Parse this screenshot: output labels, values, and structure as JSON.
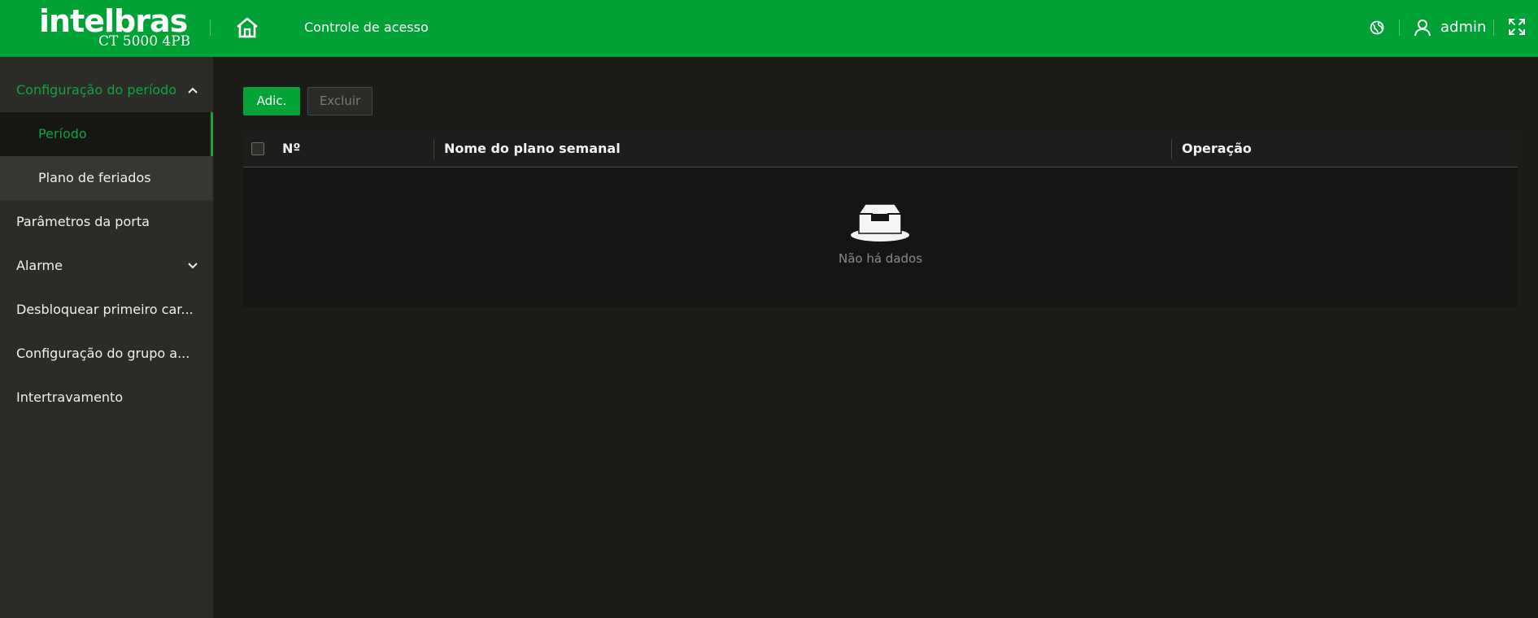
{
  "header": {
    "brand": "intelbras",
    "model": "CT 5000 4PB",
    "title": "Controle de acesso",
    "username": "admin"
  },
  "sidebar": {
    "items": [
      {
        "label": "Configuração do período",
        "state": "expanded"
      },
      {
        "label": "Período",
        "state": "selected"
      },
      {
        "label": "Plano de feriados",
        "state": "sub"
      },
      {
        "label": "Parâmetros da porta"
      },
      {
        "label": "Alarme",
        "state": "collapsed"
      },
      {
        "label": "Desbloquear primeiro car..."
      },
      {
        "label": "Configuração do grupo a..."
      },
      {
        "label": "Intertravamento"
      }
    ]
  },
  "toolbar": {
    "add_label": "Adic.",
    "delete_label": "Excluir"
  },
  "table": {
    "columns": [
      "Nº",
      "Nome do plano semanal",
      "Operação"
    ],
    "rows": [],
    "empty_text": "Não há dados"
  },
  "colors": {
    "accent": "#00a135",
    "background": "#1b1c17",
    "sidebar": "#2b2c28"
  },
  "icons": [
    "home-icon",
    "globe-icon",
    "user-icon",
    "fullscreen-icon",
    "chevron-up-icon",
    "chevron-down-icon",
    "empty-inbox-icon"
  ]
}
